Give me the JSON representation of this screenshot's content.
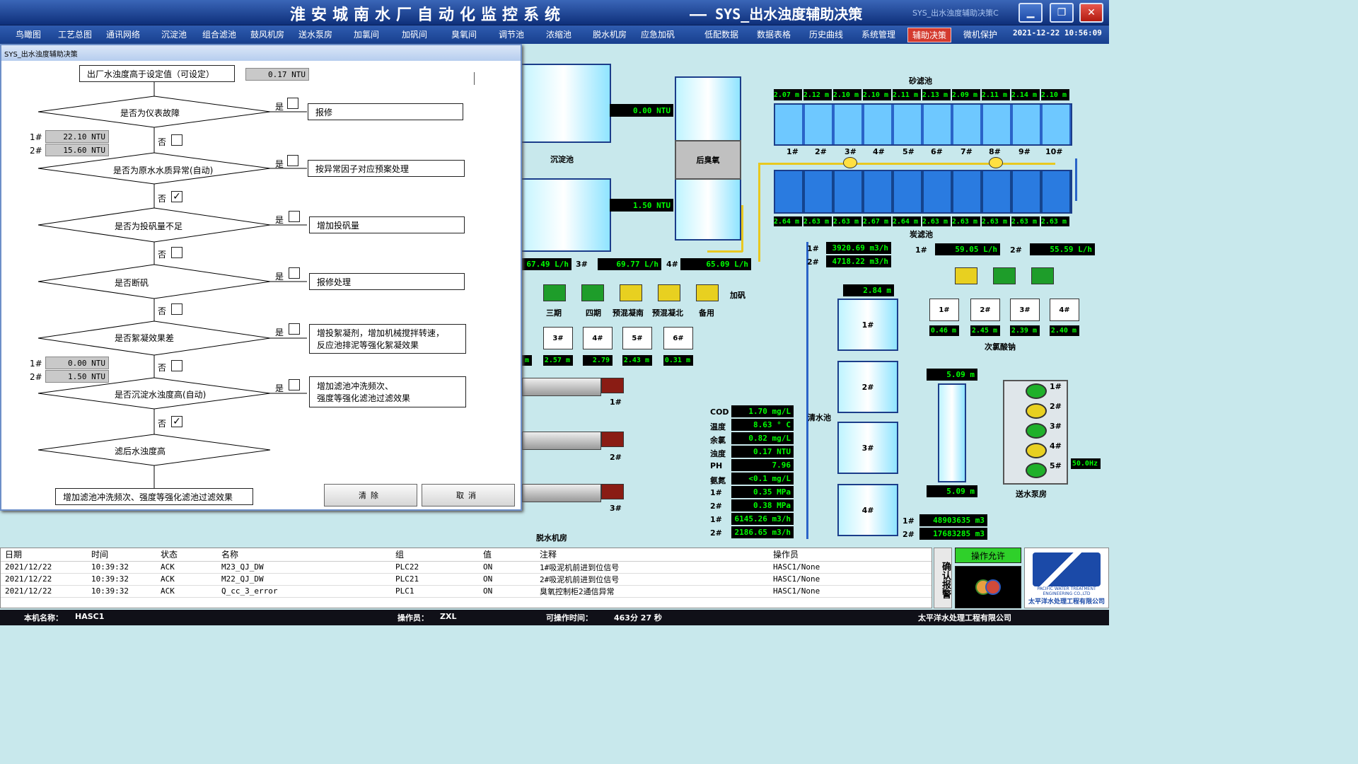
{
  "header": {
    "title": "淮安城南水厂自动化监控系统",
    "subtitle": "—— SYS_出水浊度辅助决策",
    "ghost": "SYS_出水浊度辅助决策C",
    "datetime": "2021-12-22  10:56:09"
  },
  "window_buttons": {
    "minimize": "▁",
    "restore": "❐",
    "close": "✕"
  },
  "menu": [
    "鸟瞰图",
    "工艺总图",
    "通讯网络",
    "沉淀池",
    "组合滤池",
    "鼓风机房",
    "送水泵房",
    "加氯间",
    "加矾间",
    "臭氧间",
    "调节池",
    "浓缩池",
    "脱水机房",
    "应急加矾",
    "低配数据",
    "数据表格",
    "历史曲线",
    "系统管理",
    "辅助决策",
    "微机保护"
  ],
  "plant": {
    "sed_label": "沉淀池",
    "ozone_label": "后臭氧",
    "sed_turb1": "0.00  NTU",
    "sed_turb2": "1.50  NTU",
    "sand_label": "砂滤池",
    "carbon_label": "炭滤池",
    "sand_levels": [
      "2.07 m",
      "2.12 m",
      "2.10 m",
      "2.10 m",
      "2.11 m",
      "2.13 m",
      "2.09 m",
      "2.11 m",
      "2.14 m",
      "2.10 m"
    ],
    "filter_nos": [
      "1#",
      "2#",
      "3#",
      "4#",
      "5#",
      "6#",
      "7#",
      "8#",
      "9#",
      "10#"
    ],
    "carbon_levels": [
      "2.64 m",
      "2.63 m",
      "2.63 m",
      "2.67 m",
      "2.64 m",
      "2.63 m",
      "2.63 m",
      "2.63 m",
      "2.63 m",
      "2.63 m"
    ],
    "alum_flows": [
      {
        "no": "",
        "val": "67.49  L/h"
      },
      {
        "no": "3#",
        "val": "69.77  L/h"
      },
      {
        "no": "4#",
        "val": "65.09  L/h"
      }
    ],
    "alum_label": "加矾",
    "alum_units": [
      "三期",
      "四期",
      "预混凝南",
      "预混凝北",
      "备用"
    ],
    "alum_tanks": [
      "3#",
      "4#",
      "5#",
      "6#"
    ],
    "alum_tank_levels": [
      "m",
      "2.57 m",
      "2.79",
      "2.43 m",
      "0.31 m"
    ],
    "flows": [
      {
        "no": "1#",
        "val": "3920.69 m3/h"
      },
      {
        "no": "2#",
        "val": "4718.22 m3/h"
      }
    ],
    "cl_flows": [
      {
        "no": "1#",
        "val": "59.05  L/h"
      },
      {
        "no": "2#",
        "val": "55.59  L/h"
      }
    ],
    "naclo_label": "次氯酸钠",
    "naclo_tanks": [
      "1#",
      "2#",
      "3#",
      "4#"
    ],
    "naclo_levels": [
      "0.46 m",
      "2.45 m",
      "2.39 m",
      "2.40 m"
    ],
    "clear_label": "清水池",
    "clear_level": "2.84   m",
    "clear_tanks": [
      "1#",
      "2#",
      "3#",
      "4#"
    ],
    "well_top": "5.09   m",
    "well_bot": "5.09   m",
    "pump_label": "送水泵房",
    "pump_nos": [
      "1#",
      "2#",
      "3#",
      "4#",
      "5#"
    ],
    "freq": "50.0Hz",
    "dewater_label": "脱水机房",
    "dewater_nos": [
      "1#",
      "2#",
      "3#"
    ],
    "wq": [
      {
        "k": "COD",
        "v": "1.70 mg/L"
      },
      {
        "k": "温度",
        "v": "8.63  ° C"
      },
      {
        "k": "余氯",
        "v": "0.82 mg/L"
      },
      {
        "k": "浊度",
        "v": "0.17  NTU"
      },
      {
        "k": "PH",
        "v": "7.96"
      },
      {
        "k": "氨氮",
        "v": "<0.1 mg/L"
      },
      {
        "k": "1#",
        "v": "0.35  MPa"
      },
      {
        "k": "2#",
        "v": "0.38  MPa"
      },
      {
        "k": "1#",
        "v": "6145.26 m3/h"
      },
      {
        "k": "2#",
        "v": "2186.65 m3/h"
      }
    ],
    "totals": [
      {
        "k": "1#",
        "v": "48903635 m3"
      },
      {
        "k": "2#",
        "v": "17683285 m3"
      }
    ]
  },
  "dialog": {
    "title": "SYS_出水浊度辅助决策",
    "start": "出厂水浊度高于设定值（可设定）",
    "setpoint": "0.17  NTU",
    "yes": "是",
    "no": "否",
    "steps": [
      {
        "q": "是否为仪表故障",
        "a": "报修",
        "yes_checked": false,
        "no_checked": false
      },
      {
        "q": "是否为原水水质异常(自动)",
        "a": "按异常因子对应预案处理",
        "yes_checked": false,
        "no_checked": true
      },
      {
        "q": "是否为投矾量不足",
        "a": "增加投矾量",
        "yes_checked": false,
        "no_checked": false
      },
      {
        "q": "是否断矾",
        "a": "报修处理",
        "yes_checked": false,
        "no_checked": false
      },
      {
        "q": "是否絮凝效果差",
        "a": "增投絮凝剂，增加机械搅拌转速，",
        "a2": "反应池排泥等强化絮凝效果",
        "yes_checked": false,
        "no_checked": false
      },
      {
        "q": "是否沉淀水浊度高(自动)",
        "a": "增加滤池冲洗频次、",
        "a2": "强度等强化滤池过滤效果",
        "yes_checked": false,
        "no_checked": true
      },
      {
        "q": "滤后水浊度高"
      }
    ],
    "raw_vals": [
      {
        "no": "1#",
        "v": "22.10  NTU"
      },
      {
        "no": "2#",
        "v": "15.60  NTU"
      }
    ],
    "sed_vals": [
      {
        "no": "1#",
        "v": "0.00  NTU"
      },
      {
        "no": "2#",
        "v": "1.50  NTU"
      }
    ],
    "final": "增加滤池冲洗频次、强度等强化滤池过滤效果",
    "clear_btn": "清除",
    "cancel_btn": "取消"
  },
  "alarm": {
    "headers": [
      "日期",
      "时间",
      "状态",
      "名称",
      "组",
      "值",
      "注释",
      "操作员"
    ],
    "rows": [
      [
        "2021/12/22",
        "10:39:32",
        "ACK",
        "M23_QJ_DW",
        "PLC22",
        "ON",
        "1#吸泥机前进到位信号",
        "HASC1/None"
      ],
      [
        "2021/12/22",
        "10:39:32",
        "ACK",
        "M22_QJ_DW",
        "PLC21",
        "ON",
        "2#吸泥机前进到位信号",
        "HASC1/None"
      ],
      [
        "2021/12/22",
        "10:39:32",
        "ACK",
        "Q_cc_3_error",
        "PLC1",
        "ON",
        "臭氧控制柜2通信异常",
        "HASC1/None"
      ]
    ],
    "confirm": "确认报警",
    "permit": "操作允许"
  },
  "logo": {
    "text": "太平洋水处理工程有限公司",
    "small": "PACIFIC WATER TREATMENT ENGINEERING CO.,LTD"
  },
  "status": {
    "host_label": "本机名称：",
    "host": "HASC1",
    "op_label": "操作员：",
    "op": "ZXL",
    "time_label": "可操作时间：",
    "time": "463分  27  秒",
    "company": "太平洋水处理工程有限公司"
  },
  "colors": {
    "titlebar": "#1d4aa8",
    "menu_active": "#d43a2e",
    "display_bg": "#000000",
    "display_fg": "#00ff00",
    "plant_bg": "#c8e8ec"
  }
}
